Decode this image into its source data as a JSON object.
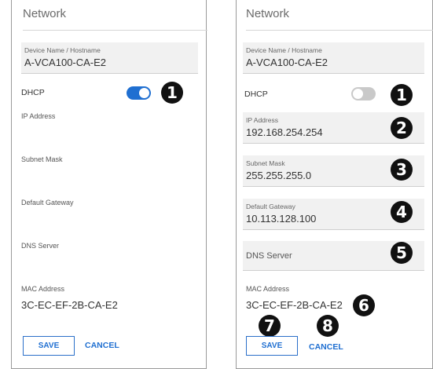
{
  "left": {
    "title": "Network",
    "device_name": {
      "label": "Device Name / Hostname",
      "value": "A-VCA100-CA-E2"
    },
    "dhcp": {
      "label": "DHCP",
      "enabled": true
    },
    "ip_address_label": "IP Address",
    "subnet_mask_label": "Subnet Mask",
    "default_gateway_label": "Default Gateway",
    "dns_server_label": "DNS Server",
    "mac": {
      "label": "MAC Address",
      "value": "3C-EC-EF-2B-CA-E2"
    },
    "save_label": "SAVE",
    "cancel_label": "CANCEL",
    "callouts": [
      "1"
    ]
  },
  "right": {
    "title": "Network",
    "device_name": {
      "label": "Device Name / Hostname",
      "value": "A-VCA100-CA-E2"
    },
    "dhcp": {
      "label": "DHCP",
      "enabled": false
    },
    "ip_address": {
      "label": "IP Address",
      "value": "192.168.254.254"
    },
    "subnet_mask": {
      "label": "Subnet Mask",
      "value": "255.255.255.0"
    },
    "default_gateway": {
      "label": "Default Gateway",
      "value": "10.113.128.100"
    },
    "dns_server": {
      "placeholder": "DNS Server"
    },
    "mac": {
      "label": "MAC Address",
      "value": "3C-EC-EF-2B-CA-E2"
    },
    "save_label": "SAVE",
    "cancel_label": "CANCEL",
    "callouts": [
      "1",
      "2",
      "3",
      "4",
      "5",
      "6",
      "7",
      "8"
    ]
  },
  "colors": {
    "accent": "#1f6fd1",
    "toggle_off": "#c9c9c9",
    "field_bg": "#f1f1f1",
    "callout": "#111111"
  }
}
